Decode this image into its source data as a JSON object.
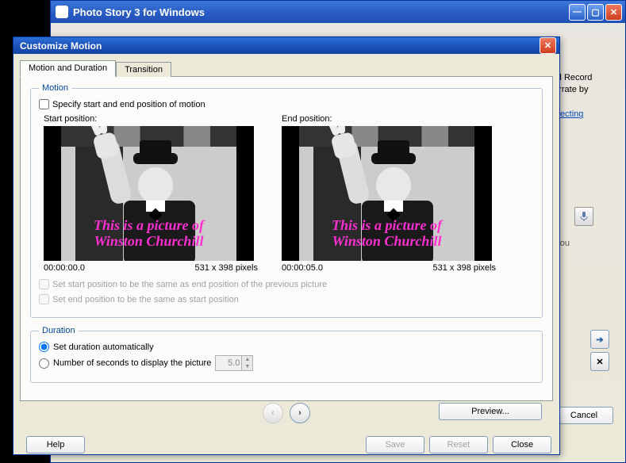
{
  "parent": {
    "title": "Photo Story 3 for Windows",
    "snippet_top": "red Record narrate by",
    "link_text": "selecting",
    "snippet_bottom": "s you",
    "cancel": "Cancel"
  },
  "dialog": {
    "title": "Customize Motion",
    "tabs": {
      "motion": "Motion and Duration",
      "transition": "Transition"
    },
    "motion": {
      "legend": "Motion",
      "specify": "Specify start and end position of motion",
      "start_label": "Start position:",
      "end_label": "End position:",
      "overlay": "This is a picture of\nWinston Churchill",
      "start_time": "00:00:00.0",
      "end_time": "00:00:05.0",
      "pixels": "531 x 398 pixels",
      "opt_same_prev": "Set start position to be the same as end position of the previous picture",
      "opt_same_start": "Set end position to be the same as start position"
    },
    "duration": {
      "legend": "Duration",
      "auto": "Set duration automatically",
      "manual": "Number of seconds to display the picture",
      "value": "5.0"
    },
    "buttons": {
      "preview": "Preview...",
      "help": "Help",
      "save": "Save",
      "reset": "Reset",
      "close": "Close"
    }
  }
}
